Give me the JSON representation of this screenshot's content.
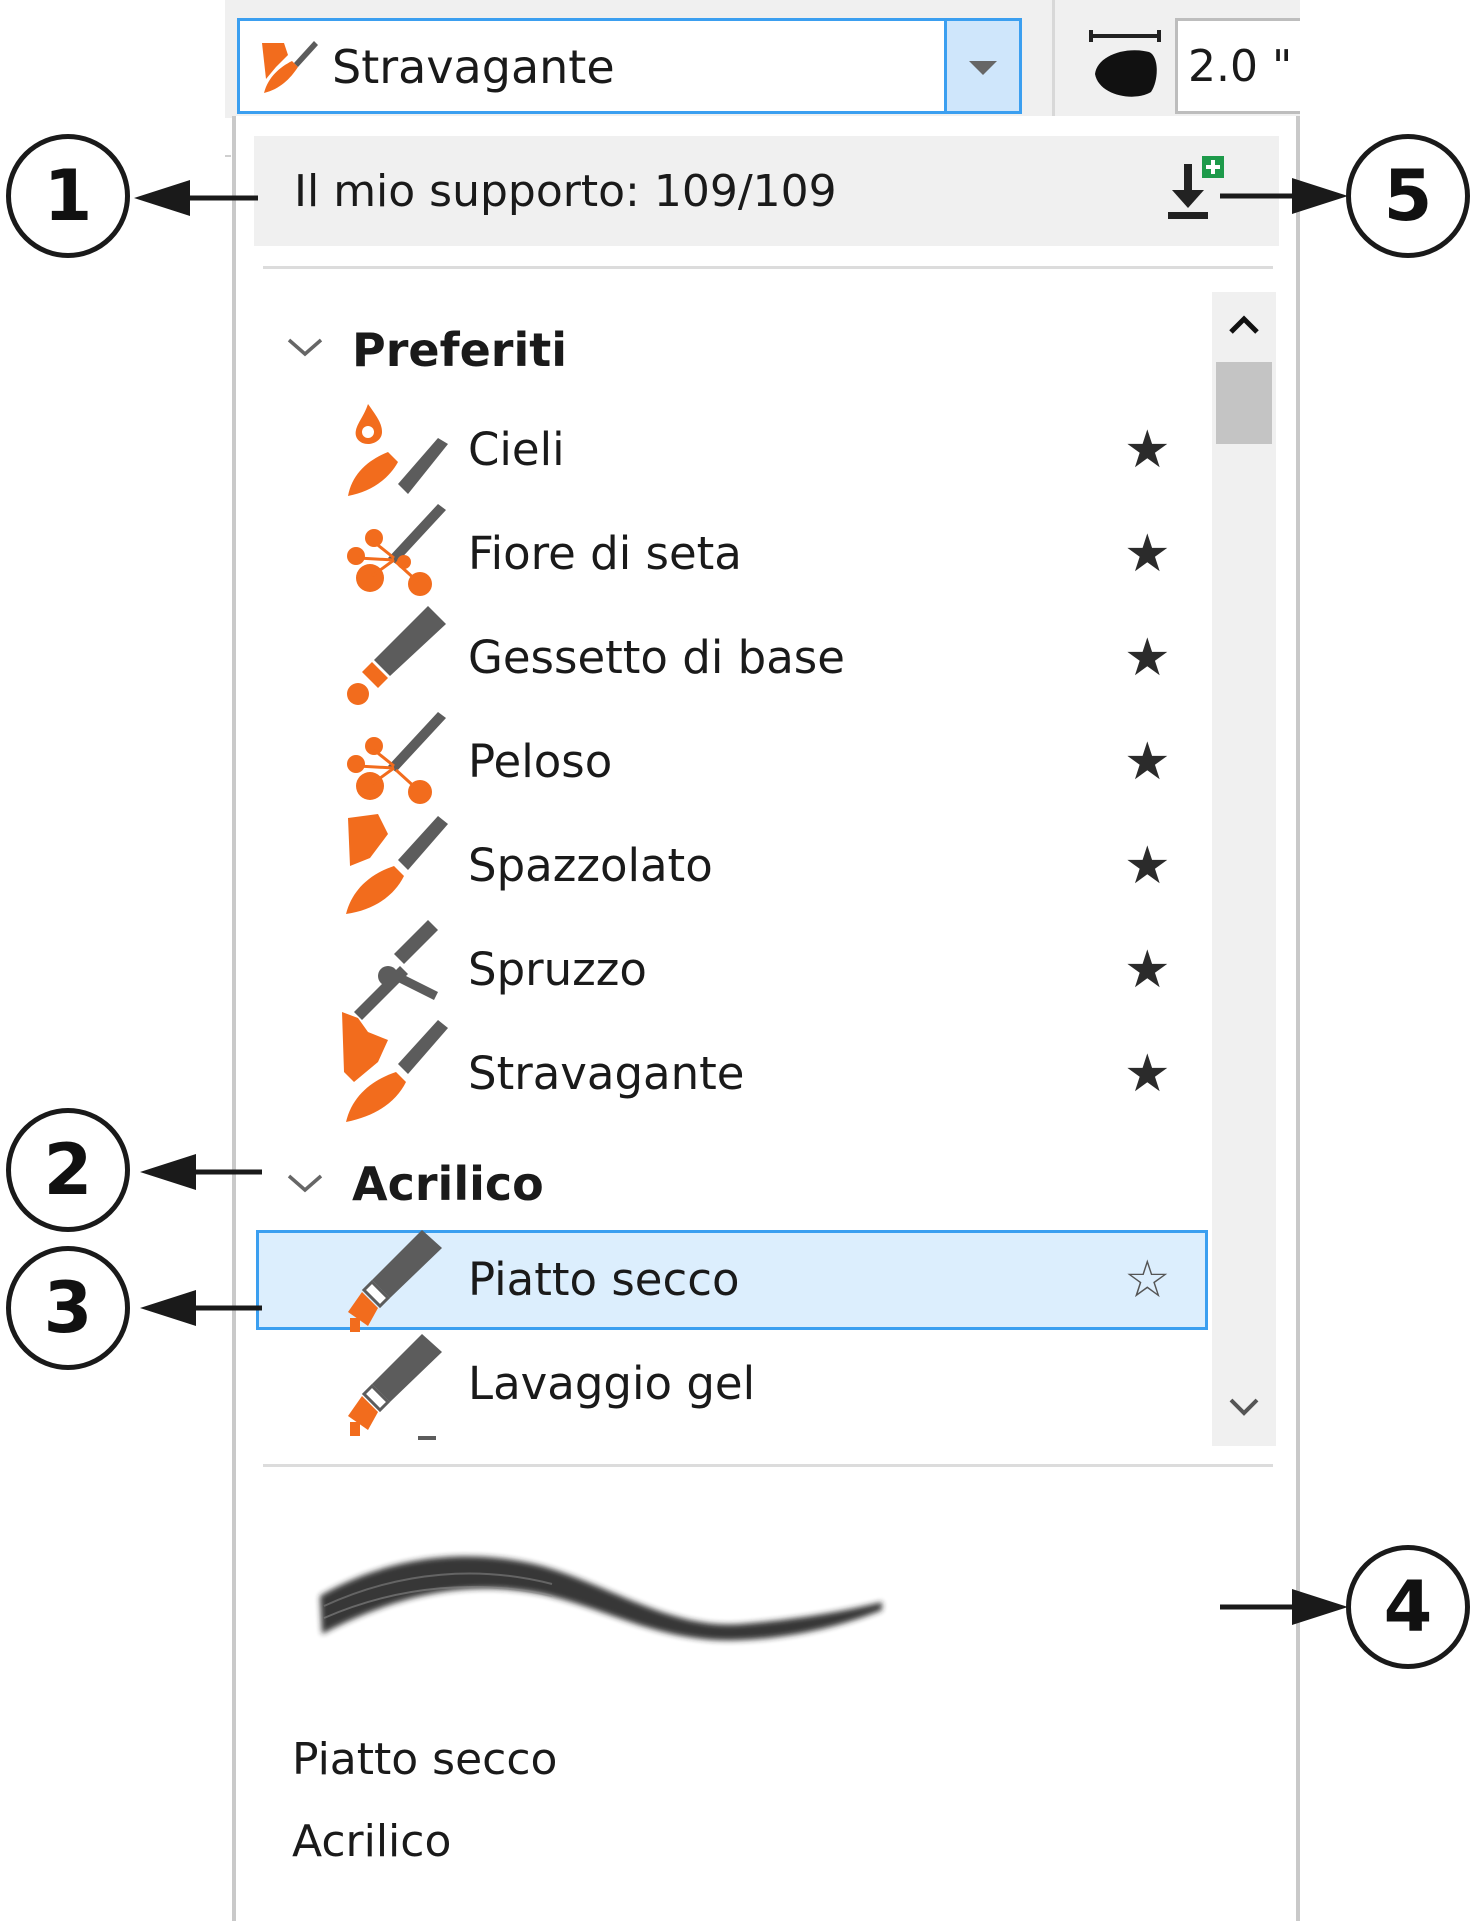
{
  "toolbar": {
    "brush_dropdown_value": "Stravagante",
    "size_value": "2.0 \""
  },
  "panel": {
    "media_header": "Il mio supporto: 109/109"
  },
  "groups": [
    {
      "name": "Preferiti",
      "items": [
        {
          "label": "Cieli",
          "icon": "skies-brush-icon",
          "favorite": true
        },
        {
          "label": "Fiore di seta",
          "icon": "silk-flower-brush-icon",
          "favorite": true
        },
        {
          "label": "Gessetto di base",
          "icon": "chalk-brush-icon",
          "favorite": true
        },
        {
          "label": "Peloso",
          "icon": "hairy-brush-icon",
          "favorite": true
        },
        {
          "label": "Spazzolato",
          "icon": "brushed-brush-icon",
          "favorite": true
        },
        {
          "label": "Spruzzo",
          "icon": "spray-brush-icon",
          "favorite": true
        },
        {
          "label": "Stravagante",
          "icon": "fancy-brush-icon",
          "favorite": true
        }
      ]
    },
    {
      "name": "Acrilico",
      "items": [
        {
          "label": "Piatto secco",
          "icon": "flat-brush-icon",
          "favorite": false,
          "selected": true
        },
        {
          "label": "Lavaggio gel",
          "icon": "flat-brush-icon",
          "favorite": false
        }
      ]
    }
  ],
  "preview": {
    "brush_name": "Piatto secco",
    "category": "Acrilico"
  },
  "callouts": [
    "1",
    "2",
    "3",
    "4",
    "5"
  ],
  "colors": {
    "accent": "#3b9ff0",
    "selection_bg": "#dceefd",
    "brush_orange": "#f26c1d",
    "brush_gray": "#5c5c5c"
  }
}
